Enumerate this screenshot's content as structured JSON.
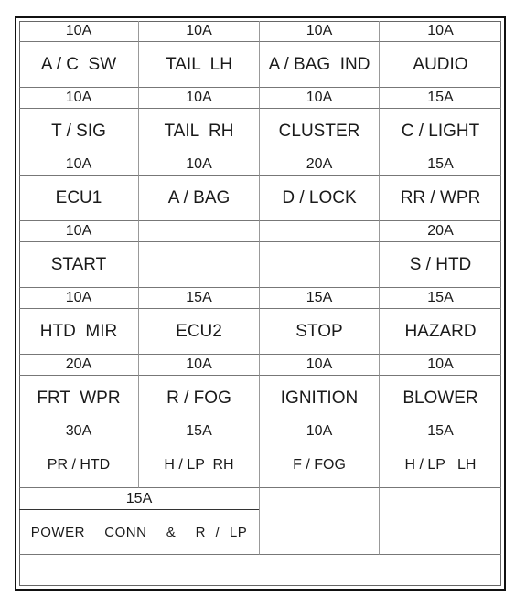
{
  "fuse_panel": {
    "rows": [
      {
        "fuses": [
          {
            "rating": "10A",
            "name": "A / C  SW"
          },
          {
            "rating": "10A",
            "name": "TAIL  LH"
          },
          {
            "rating": "10A",
            "name": "A / BAG  IND"
          },
          {
            "rating": "10A",
            "name": "AUDIO"
          }
        ]
      },
      {
        "fuses": [
          {
            "rating": "10A",
            "name": "T / SIG"
          },
          {
            "rating": "10A",
            "name": "TAIL  RH"
          },
          {
            "rating": "10A",
            "name": "CLUSTER"
          },
          {
            "rating": "15A",
            "name": "C / LIGHT"
          }
        ]
      },
      {
        "fuses": [
          {
            "rating": "10A",
            "name": "ECU1"
          },
          {
            "rating": "10A",
            "name": "A / BAG"
          },
          {
            "rating": "20A",
            "name": "D / LOCK"
          },
          {
            "rating": "15A",
            "name": "RR / WPR"
          }
        ]
      },
      {
        "fuses": [
          {
            "rating": "10A",
            "name": "START"
          },
          {
            "rating": "",
            "name": ""
          },
          {
            "rating": "",
            "name": ""
          },
          {
            "rating": "20A",
            "name": "S / HTD"
          }
        ]
      },
      {
        "fuses": [
          {
            "rating": "10A",
            "name": "HTD  MIR"
          },
          {
            "rating": "15A",
            "name": "ECU2"
          },
          {
            "rating": "15A",
            "name": "STOP"
          },
          {
            "rating": "15A",
            "name": "HAZARD"
          }
        ]
      },
      {
        "fuses": [
          {
            "rating": "20A",
            "name": "FRT  WPR"
          },
          {
            "rating": "10A",
            "name": "R / FOG"
          },
          {
            "rating": "10A",
            "name": "IGNITION"
          },
          {
            "rating": "10A",
            "name": "BLOWER"
          }
        ]
      },
      {
        "fuses": [
          {
            "rating": "30A",
            "name": "PR / HTD"
          },
          {
            "rating": "15A",
            "name": "H / LP  RH"
          },
          {
            "rating": "10A",
            "name": "F / FOG"
          },
          {
            "rating": "15A",
            "name": "H / LP   LH"
          }
        ]
      }
    ],
    "wide_fuse": {
      "rating": "15A",
      "name": "POWER  CONN  &  R / LP"
    }
  }
}
